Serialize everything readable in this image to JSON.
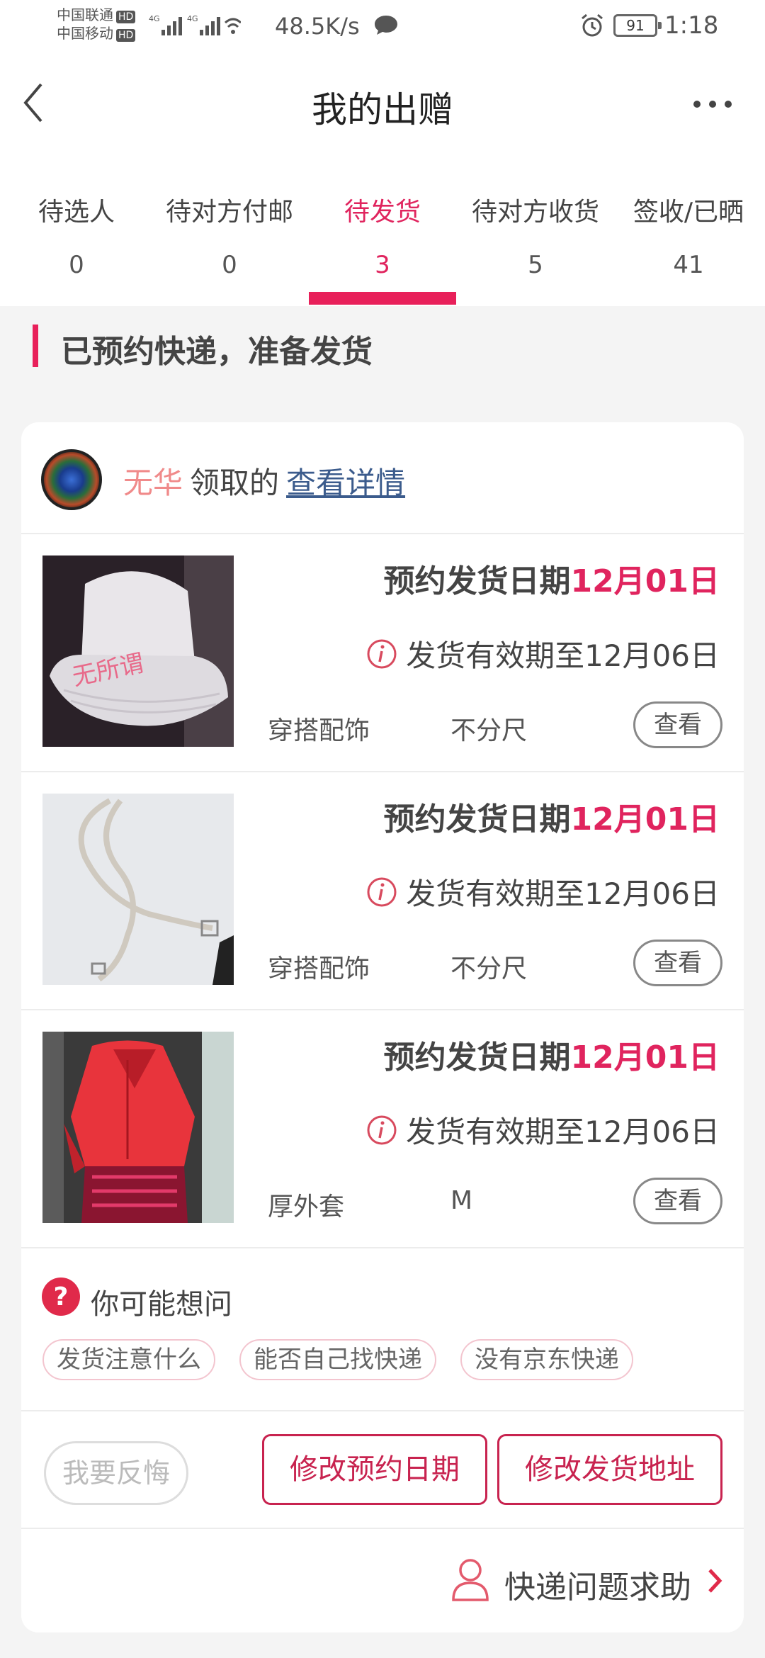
{
  "status_bar": {
    "carrier_1": "中国联通",
    "carrier_2": "中国移动",
    "hd_badge": "HD",
    "network": "4G",
    "speed": "48.5K/s",
    "battery": "91",
    "time": "1:18",
    "icons": [
      "signal-icon",
      "wifi-icon",
      "chat-icon",
      "alarm-icon",
      "battery-icon"
    ]
  },
  "header": {
    "title": "我的出赠",
    "back_icon": "back-arrow-icon",
    "more_icon": "more-dots-icon"
  },
  "tabs": [
    {
      "label": "待选人",
      "count": "0",
      "active": false
    },
    {
      "label": "待对方付邮",
      "count": "0",
      "active": false
    },
    {
      "label": "待发货",
      "count": "3",
      "active": true
    },
    {
      "label": "待对方收货",
      "count": "5",
      "active": false
    },
    {
      "label": "签收/已晒",
      "count": "41",
      "active": false
    }
  ],
  "section": {
    "title": "已预约快递，准备发货"
  },
  "receiver": {
    "name": "无华",
    "action": "领取的",
    "link": "查看详情"
  },
  "items": [
    {
      "ship_label": "预约发货日期",
      "ship_date": "12月01日",
      "validity": "发货有效期至12月06日",
      "category": "穿搭配饰",
      "size": "不分尺",
      "view": "查看",
      "image_text": "无所谓"
    },
    {
      "ship_label": "预约发货日期",
      "ship_date": "12月01日",
      "validity": "发货有效期至12月06日",
      "category": "穿搭配饰",
      "size": "不分尺",
      "view": "查看"
    },
    {
      "ship_label": "预约发货日期",
      "ship_date": "12月01日",
      "validity": "发货有效期至12月06日",
      "category": "厚外套",
      "size": "M",
      "view": "查看"
    }
  ],
  "faq": {
    "title": "你可能想问",
    "chips": [
      "发货注意什么",
      "能否自己找快递",
      "没有京东快递"
    ]
  },
  "actions": {
    "regret": "我要反悔",
    "change_date": "修改预约日期",
    "change_address": "修改发货地址"
  },
  "help": {
    "label": "快递问题求助"
  },
  "colors": {
    "accent": "#e8205a",
    "link": "#3b5b8c",
    "receiver_name": "#f08a8a"
  }
}
